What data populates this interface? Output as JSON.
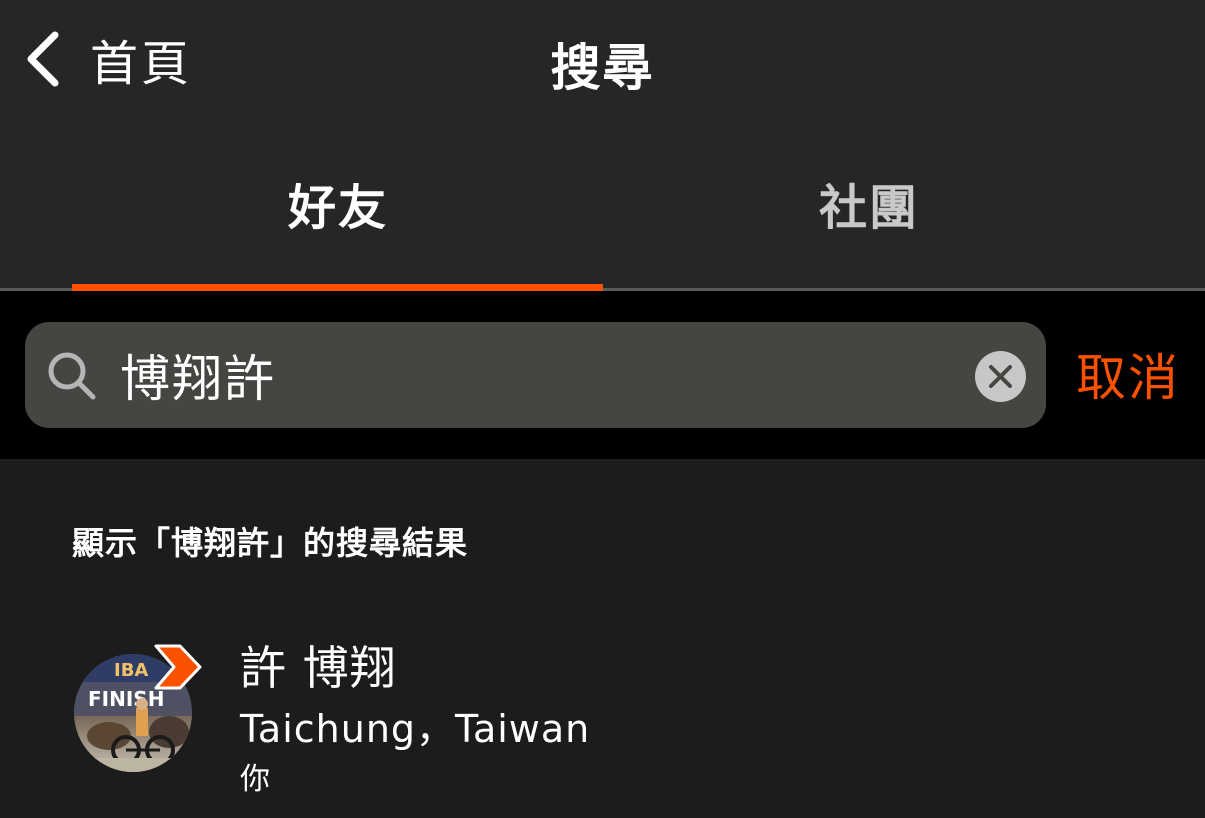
{
  "nav": {
    "back_label": "首頁",
    "title": "搜尋"
  },
  "tabs": [
    {
      "label": "好友",
      "selected": true
    },
    {
      "label": "社團",
      "selected": false
    }
  ],
  "search": {
    "value": "博翔許",
    "placeholder": "",
    "cancel_label": "取消"
  },
  "results": {
    "header": "顯示「博翔許」的搜尋結果",
    "items": [
      {
        "name": "許 博翔",
        "location": "Taichung，Taiwan",
        "relation": "你",
        "avatar_text": "FINISH",
        "avatar_banner": "IBA"
      }
    ]
  },
  "colors": {
    "accent": "#fc5200",
    "background": "#1c1c1c",
    "bar_background": "#262626",
    "search_field": "#474542",
    "inactive_tab": "#c9c9c9"
  },
  "icons": {
    "back": "chevron-left-icon",
    "search": "magnifier-icon",
    "clear": "clear-x-icon",
    "badge": "strava-chevron-badge-icon"
  }
}
